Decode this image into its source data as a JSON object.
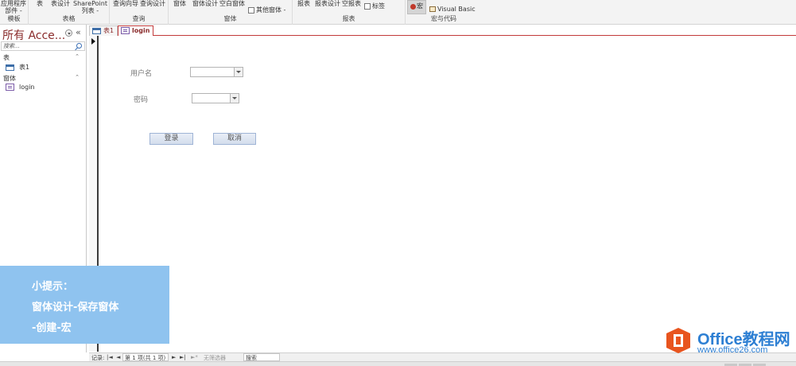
{
  "ribbon": {
    "groups": [
      {
        "label": "模板",
        "buttons": [
          "应用程序",
          "部件 -"
        ]
      },
      {
        "label": "表格",
        "buttons": [
          "表",
          "表设计",
          "SharePoint",
          "列表 -"
        ]
      },
      {
        "label": "查询",
        "buttons": [
          "查询向导",
          "查询设计"
        ]
      },
      {
        "label": "窗体",
        "buttons": [
          "窗体",
          "窗体设计",
          "空白窗体",
          "其他窗体 -"
        ]
      },
      {
        "label": "报表",
        "buttons": [
          "报表",
          "报表设计",
          "空报表",
          "标签"
        ]
      },
      {
        "label": "宏与代码",
        "buttons": [
          "宏",
          "Visual Basic"
        ]
      }
    ]
  },
  "nav": {
    "title": "所有 Acce...",
    "collapse_glyph": "«",
    "search_placeholder": "搜索...",
    "groups": [
      {
        "label": "表",
        "items": [
          "表1"
        ]
      },
      {
        "label": "窗体",
        "items": [
          "login"
        ]
      }
    ]
  },
  "tabs": [
    {
      "label": "表1",
      "active": false
    },
    {
      "label": "login",
      "active": true
    }
  ],
  "form": {
    "username_label": "用户名",
    "password_label": "密码",
    "username_value": "",
    "password_value": "",
    "login_button": "登录",
    "cancel_button": "取消"
  },
  "record_nav": {
    "label": "记录:",
    "first": "|◄",
    "prev": "◄",
    "position": "第 1 项(共 1 项)",
    "next": "►",
    "last": "►|",
    "new": "►*",
    "filter": "无筛选器",
    "search": "搜索"
  },
  "tip": {
    "line1": "小提示：",
    "line2": "窗体设计-保存窗体",
    "line3": "-创建-宏"
  },
  "watermark": {
    "brand": "Office教程网",
    "url": "www.office26.com"
  },
  "colors": {
    "accent": "#8a2b2b",
    "tab_border": "#c23b3b",
    "tip_bg": "#8fc3ef",
    "watermark": "#2d7fd3"
  }
}
